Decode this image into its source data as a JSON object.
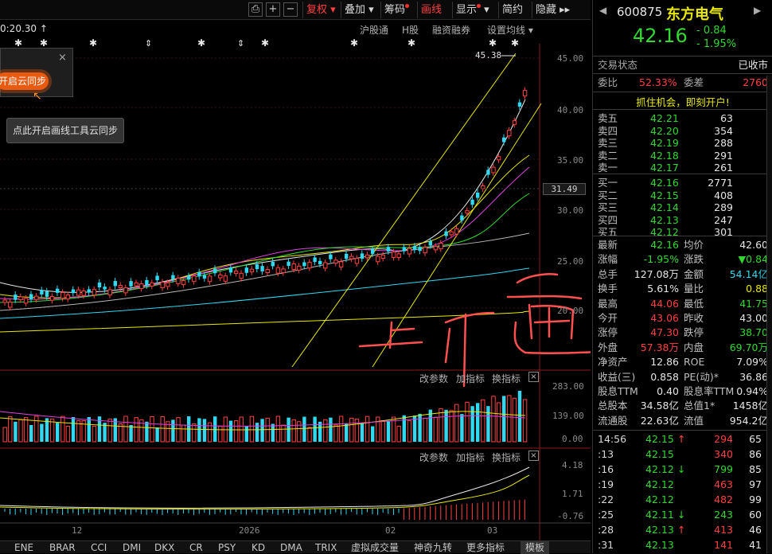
{
  "toolbar": {
    "buttons": [
      "复权",
      "叠加",
      "筹码",
      "画线",
      "显示",
      "简约",
      "隐藏"
    ],
    "nav_glyph": "▸▸"
  },
  "chart": {
    "time_label": "0:20.30",
    "header_links": [
      "沪股通",
      "H股",
      "融资融券",
      "设置均线"
    ],
    "price_axis": [
      "45.00",
      "40.00",
      "35.00",
      "30.00",
      "25.00",
      "20.00"
    ],
    "current_price_tag": "31.49",
    "high_marker": "45.38",
    "x_labels": [
      "12",
      "2026",
      "02",
      "03"
    ],
    "handwritten_text": "上升通道",
    "volume_header": {
      "params": "改参数",
      "add": "加指标",
      "switch": "换指标"
    },
    "volume_axis": [
      "283.00",
      "139.00",
      "0.00"
    ],
    "macd_header": {
      "params": "改参数",
      "add": "加指标",
      "switch": "换指标"
    },
    "macd_axis": [
      "4.18",
      "1.71",
      "-0.76"
    ],
    "cloud_popup": {
      "button": "开启云同步",
      "tip": "点此开启画线工具云同步"
    }
  },
  "bottom_tabs": [
    "ENE",
    "BRAR",
    "CCI",
    "DMI",
    "DKX",
    "CR",
    "PSY",
    "KD",
    "DMA",
    "TRIX",
    "虚拟成交量",
    "神奇九转",
    "更多指标",
    "模板"
  ],
  "quote": {
    "code": "600875",
    "name": "东方电气",
    "price": "42.16",
    "change": "- 0.84",
    "change_pct": "- 1.95%",
    "status_label": "交易状态",
    "status_value": "已收市",
    "webi_label": "委比",
    "webi_value": "52.33%",
    "weicha_label": "委差",
    "weicha_value": "2760",
    "promo": "抓住机会，即刻开户!",
    "asks": [
      {
        "label": "卖五",
        "price": "42.21",
        "vol": "63"
      },
      {
        "label": "卖四",
        "price": "42.20",
        "vol": "354"
      },
      {
        "label": "卖三",
        "price": "42.19",
        "vol": "288"
      },
      {
        "label": "卖二",
        "price": "42.18",
        "vol": "291"
      },
      {
        "label": "卖一",
        "price": "42.17",
        "vol": "261"
      }
    ],
    "bids": [
      {
        "label": "买一",
        "price": "42.16",
        "vol": "2771"
      },
      {
        "label": "买二",
        "price": "42.15",
        "vol": "408"
      },
      {
        "label": "买三",
        "price": "42.14",
        "vol": "289"
      },
      {
        "label": "买四",
        "price": "42.13",
        "vol": "247"
      },
      {
        "label": "买五",
        "price": "42.12",
        "vol": "301"
      }
    ],
    "stats": [
      {
        "l1": "最新",
        "v1": "42.16",
        "c1": "green",
        "l2": "均价",
        "v2": "42.60",
        "c2": "white"
      },
      {
        "l1": "涨幅",
        "v1": "-1.95%",
        "c1": "green",
        "l2": "涨跌",
        "v2": "▼0.84",
        "c2": "green"
      },
      {
        "l1": "总手",
        "v1": "127.08万",
        "c1": "white",
        "l2": "金额",
        "v2": "54.14亿",
        "c2": "cyan"
      },
      {
        "l1": "换手",
        "v1": "5.61%",
        "c1": "white",
        "l2": "量比",
        "v2": "0.88",
        "c2": "yellow"
      },
      {
        "l1": "最高",
        "v1": "44.06",
        "c1": "red",
        "l2": "最低",
        "v2": "41.75",
        "c2": "green"
      },
      {
        "l1": "今开",
        "v1": "43.06",
        "c1": "red",
        "l2": "昨收",
        "v2": "43.00",
        "c2": "white"
      },
      {
        "l1": "涨停",
        "v1": "47.30",
        "c1": "red",
        "l2": "跌停",
        "v2": "38.70",
        "c2": "green"
      },
      {
        "l1": "外盘",
        "v1": "57.38万",
        "c1": "red",
        "l2": "内盘",
        "v2": "69.70万",
        "c2": "green"
      },
      {
        "l1": "净资产",
        "v1": "12.86",
        "c1": "white",
        "l2": "ROE",
        "v2": "7.09%",
        "c2": "white"
      },
      {
        "l1": "收益(三)",
        "v1": "0.858",
        "c1": "white",
        "l2": "PE(动)*",
        "v2": "36.86",
        "c2": "white"
      },
      {
        "l1": "股息TTM",
        "v1": "0.40",
        "c1": "white",
        "l2": "股息率TTM",
        "v2": "0.94%",
        "c2": "white"
      },
      {
        "l1": "总股本",
        "v1": "34.58亿",
        "c1": "white",
        "l2": "总值1*",
        "v2": "1458亿",
        "c2": "white"
      },
      {
        "l1": "流通股",
        "v1": "22.63亿",
        "c1": "white",
        "l2": "流值",
        "v2": "954.2亿",
        "c2": "white"
      }
    ],
    "ticks": [
      {
        "t": "14:56",
        "p": "42.15",
        "arrow": "↑",
        "v": "294",
        "vc": "red",
        "c": "65"
      },
      {
        "t": ":13",
        "p": "42.15",
        "arrow": "",
        "v": "340",
        "vc": "red",
        "c": "86"
      },
      {
        "t": ":16",
        "p": "42.12",
        "arrow": "↓",
        "v": "799",
        "vc": "green",
        "c": "85"
      },
      {
        "t": ":19",
        "p": "42.12",
        "arrow": "",
        "v": "463",
        "vc": "red",
        "c": "97"
      },
      {
        "t": ":22",
        "p": "42.12",
        "arrow": "",
        "v": "482",
        "vc": "red",
        "c": "99"
      },
      {
        "t": ":25",
        "p": "42.11",
        "arrow": "↓",
        "v": "243",
        "vc": "green",
        "c": "60"
      },
      {
        "t": ":28",
        "p": "42.13",
        "arrow": "↑",
        "v": "413",
        "vc": "red",
        "c": "46"
      },
      {
        "t": ":31",
        "p": "42.13",
        "arrow": "",
        "v": "141",
        "vc": "red",
        "c": "41"
      }
    ]
  }
}
